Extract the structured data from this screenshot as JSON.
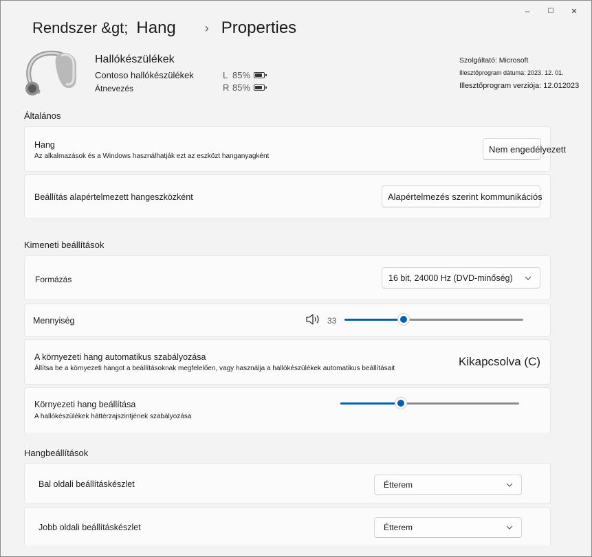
{
  "window": {
    "controls": {
      "minimize": "–",
      "maximize": "☐",
      "close": "✕"
    }
  },
  "breadcrumb": {
    "part1": "Rendszer &gt;",
    "part2": "Hang",
    "separator": "›",
    "part3": "Properties"
  },
  "device": {
    "name": "Hallókészülékek",
    "model": "Contoso hallókészülékek",
    "rename": "Átnevezés",
    "battery_left": {
      "side": "L",
      "percent": "85%",
      "level": 0.85
    },
    "battery_right": {
      "side": "R",
      "percent": "85%",
      "level": 0.85
    },
    "provider": "Szolgáltató: Microsoft",
    "driver_date": "Illesztőprogram dátuma: 2023. 12. 01.",
    "driver_version": "Illesztőprogram verziója: 12.012023"
  },
  "general": {
    "title": "Általános",
    "audio": {
      "title": "Hang",
      "subtitle": "Az alkalmazások és a Windows használhatják ezt az eszközt hanganyagként",
      "button": "Nem engedélyezett"
    },
    "default_device": {
      "title": "Beállítás alapértelmezett hangeszközként",
      "button": "Alapértelmezés szerint kommunikációs"
    }
  },
  "output": {
    "title": "Kimeneti beállítások",
    "format": {
      "title": "Formázás",
      "value": "16 bit, 24000 Hz (DVD-minőség)"
    },
    "volume": {
      "title": "Mennyiség",
      "value_text": "33",
      "level": 0.33
    },
    "ambient_auto": {
      "title": "A környezeti hang automatikus szabályozása",
      "subtitle": "Állítsa be a környezeti hangot a beállításoknak megfelelően, vagy használja a hallókészülékek automatikus beállításait",
      "status": "Kikapcsolva (C)"
    },
    "ambient_level": {
      "title": "Környezeti hang beállítása",
      "subtitle": "A hallókészülékek háttérzajszintjének szabályozása",
      "level": 0.34
    }
  },
  "sound": {
    "title": "Hangbeállítások",
    "left_preset": {
      "title": "Bal oldali beállításkészlet",
      "value": "Étterem"
    },
    "right_preset": {
      "title": "Jobb oldali beállításkészlet",
      "value": "Étterem"
    }
  },
  "colors": {
    "accent": "#005fb8",
    "background": "#f3f3f3",
    "card": "#fbfbfb"
  }
}
